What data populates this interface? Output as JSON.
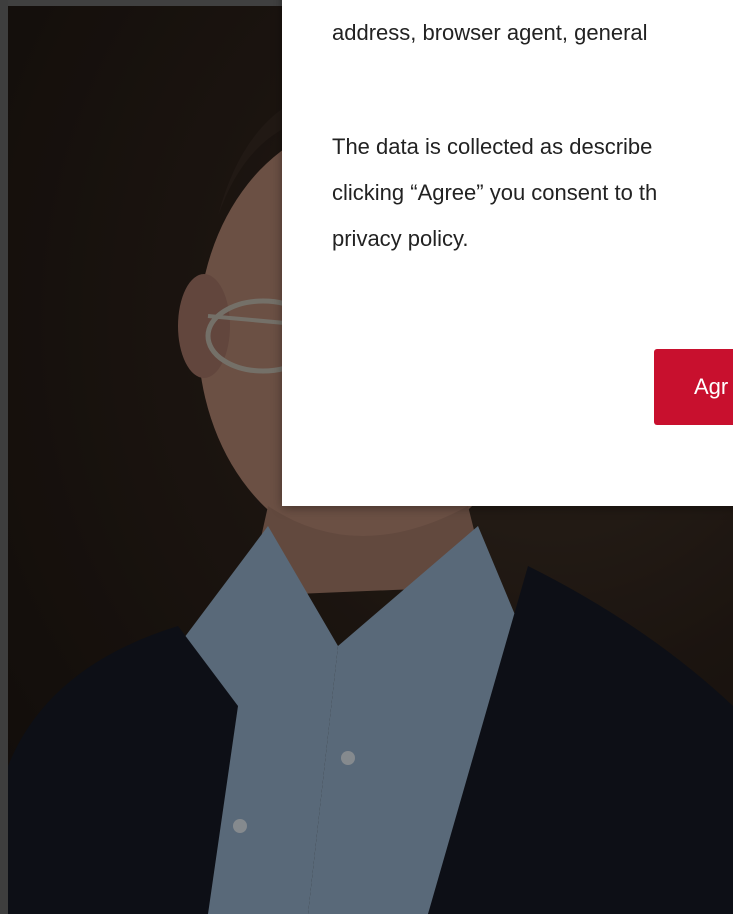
{
  "consent_modal": {
    "line_1": "address, browser agent, general",
    "paragraph_2_line_1": "The data is collected as describe",
    "paragraph_2_line_2": "clicking “Agree” you consent to th",
    "paragraph_2_line_3": "privacy policy.",
    "agree_button_label": "Agr"
  },
  "colors": {
    "accent": "#c8102e",
    "modal_background": "#ffffff",
    "text": "#222222",
    "overlay": "rgba(0,0,0,0.42)"
  }
}
